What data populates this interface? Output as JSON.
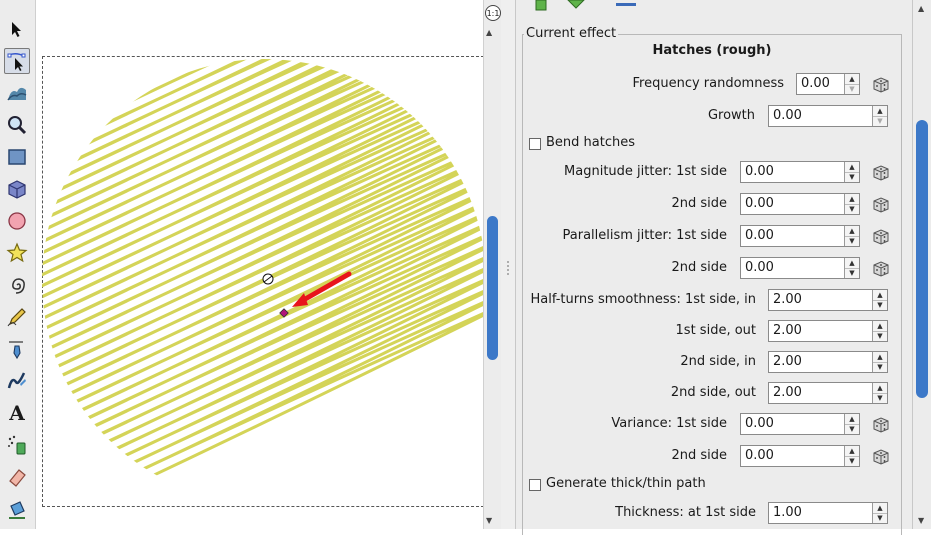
{
  "toolbox": {
    "tools": [
      {
        "name": "selector-tool-icon",
        "active": false
      },
      {
        "name": "node-tool-icon",
        "active": true
      },
      {
        "name": "tweak-tool-icon",
        "active": false
      },
      {
        "name": "zoom-tool-icon",
        "active": false
      },
      {
        "name": "rectangle-tool-icon",
        "active": false
      },
      {
        "name": "3d-box-tool-icon",
        "active": false
      },
      {
        "name": "ellipse-tool-icon",
        "active": false
      },
      {
        "name": "star-tool-icon",
        "active": false
      },
      {
        "name": "spiral-tool-icon",
        "active": false
      },
      {
        "name": "pencil-tool-icon",
        "active": false
      },
      {
        "name": "pen-tool-icon",
        "active": false
      },
      {
        "name": "calligraphy-tool-icon",
        "active": false
      },
      {
        "name": "text-tool-icon",
        "active": false
      },
      {
        "name": "spray-tool-icon",
        "active": false
      },
      {
        "name": "eraser-tool-icon",
        "active": false
      },
      {
        "name": "paint-bucket-tool-icon",
        "active": false
      }
    ],
    "text_tool_glyph": "A"
  },
  "canvas": {
    "hatch_color": "#d4d458",
    "arrow_color": "#e8141c",
    "handle_color": "#b0157a"
  },
  "zoom_button_label": "1:1",
  "panel": {
    "frame_title": "Current effect",
    "effect_title": "Hatches (rough)",
    "fields": {
      "frequency_randomness": {
        "label": "Frequency randomness",
        "value": "0.00"
      },
      "growth": {
        "label": "Growth",
        "value": "0.00"
      },
      "bend_hatches": {
        "label": "Bend hatches",
        "checked": false
      },
      "magnitude_jitter_1st": {
        "label": "Magnitude jitter: 1st side",
        "value": "0.00"
      },
      "magnitude_jitter_2nd": {
        "label": "2nd side",
        "value": "0.00"
      },
      "parallelism_jitter_1st": {
        "label": "Parallelism jitter: 1st side",
        "value": "0.00"
      },
      "parallelism_jitter_2nd": {
        "label": "2nd side",
        "value": "0.00"
      },
      "half_turns_1st_in": {
        "label": "Half-turns smoothness: 1st side, in",
        "value": "2.00"
      },
      "half_turns_1st_out": {
        "label": "1st side, out",
        "value": "2.00"
      },
      "half_turns_2nd_in": {
        "label": "2nd side, in",
        "value": "2.00"
      },
      "half_turns_2nd_out": {
        "label": "2nd side, out",
        "value": "2.00"
      },
      "variance_1st": {
        "label": "Variance: 1st side",
        "value": "0.00"
      },
      "variance_2nd": {
        "label": "2nd side",
        "value": "0.00"
      },
      "generate_thick_thin": {
        "label": "Generate thick/thin path",
        "checked": false
      },
      "thickness_1st": {
        "label": "Thickness: at 1st side",
        "value": "1.00"
      }
    }
  }
}
